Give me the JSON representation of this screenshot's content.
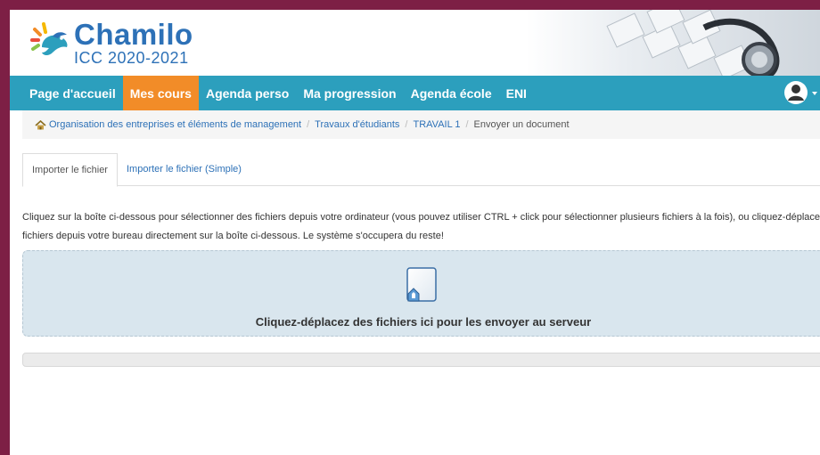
{
  "header": {
    "logo_title": "Chamilo",
    "logo_subtitle": "ICC 2020-2021"
  },
  "navbar": {
    "items": [
      {
        "label": "Page d'accueil",
        "active": false
      },
      {
        "label": "Mes cours",
        "active": true
      },
      {
        "label": "Agenda perso",
        "active": false
      },
      {
        "label": "Ma progression",
        "active": false
      },
      {
        "label": "Agenda école",
        "active": false
      },
      {
        "label": "ENI",
        "active": false
      }
    ],
    "colors": {
      "bar": "#2c9fbd",
      "active": "#f28c28"
    }
  },
  "breadcrumb": {
    "items": [
      "Organisation des entreprises et éléments de management",
      "Travaux d'étudiants",
      "TRAVAIL 1"
    ],
    "current": "Envoyer un document",
    "separator": "/"
  },
  "tabs": [
    {
      "label": "Importer le fichier",
      "active": true
    },
    {
      "label": "Importer le fichier (Simple)",
      "active": false
    }
  ],
  "instructions": {
    "line1": "Cliquez sur la boîte ci-dessous pour sélectionner des fichiers depuis votre ordinateur (vous pouvez utiliser CTRL + click pour sélectionner plusieurs fichiers à la fois), ou cliquez-déplacez des",
    "line2": "fichiers depuis votre bureau directement sur la boîte ci-dessous. Le système s'occupera du reste!"
  },
  "dropzone": {
    "label": "Cliquez-déplacez des fichiers ici pour les envoyer au serveur"
  },
  "upload_progress": 0
}
